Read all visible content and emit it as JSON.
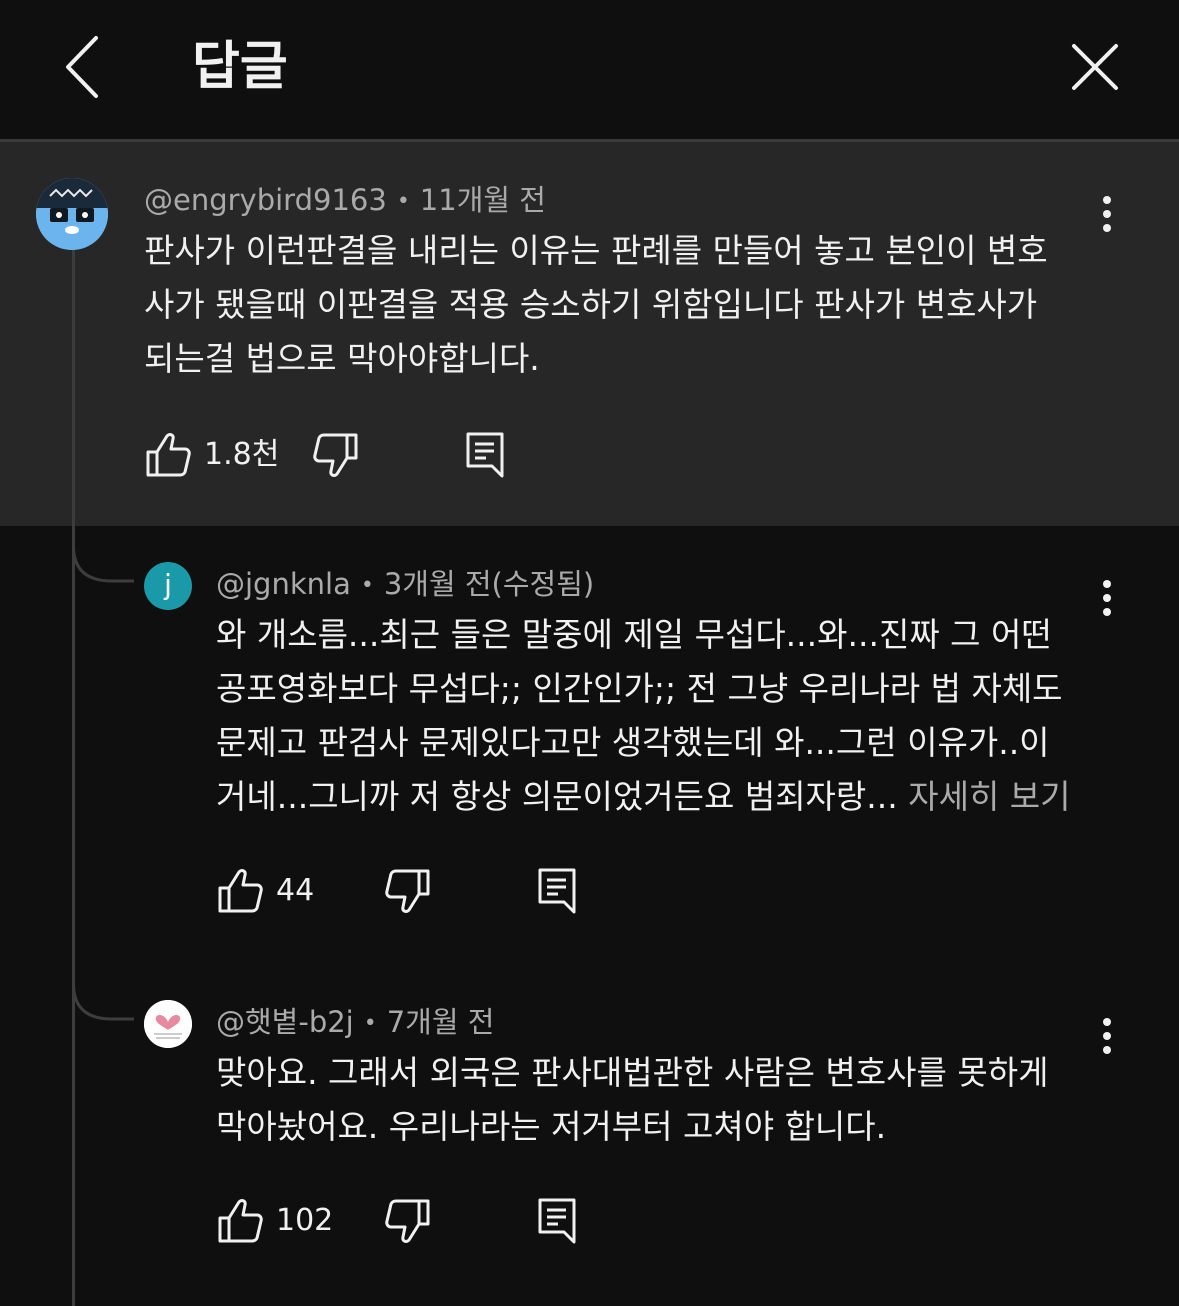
{
  "header": {
    "title": "답글"
  },
  "parent_comment": {
    "handle": "@engrybird9163",
    "time": "11개월 전",
    "lines": [
      "판사가 이런판결을 내리는 이유는 판례를 만들어 놓고 본인이 변호",
      "사가 됐을때 이판결을 적용 승소하기 위함입니다 판사가 변호사가",
      "되는걸 법으로 막아야합니다."
    ],
    "likes": "1.8천"
  },
  "replies": [
    {
      "handle": "@jgnknla",
      "time": "3개월 전(수정됨)",
      "avatar_letter": "j",
      "lines": [
        "와 개소름...최근 들은 말중에 제일 무섭다...와...진짜 그 어떤",
        "공포영화보다 무섭다;; 인간인가;; 전 그냥 우리나라 법 자체도",
        "문제고 판검사 문제있다고만 생각했는데 와...그런 이유가..이",
        "거네...그니까 저 항상 의문이었거든요 범죄자랑... "
      ],
      "more_label": "자세히 보기",
      "likes": "44"
    },
    {
      "handle": "@햇볕-b2j",
      "time": "7개월 전",
      "lines": [
        "맞아요. 그래서 외국은 판사대법관한 사람은 변호사를 못하게",
        "막아놨어요. 우리나라는 저거부터 고쳐야 합니다."
      ],
      "likes": "102"
    }
  ],
  "colors": {
    "background": "#0f0f0f",
    "parent_highlight": "#272727",
    "text_primary": "#f1f1f1",
    "text_secondary": "#aaaaaa",
    "avatar_teal": "#1a9aa8"
  },
  "icons": {
    "back": "chevron-left-icon",
    "close": "close-icon",
    "like": "thumb-up-icon",
    "dislike": "thumb-down-icon",
    "reply": "reply-comment-icon",
    "more": "more-vertical-icon"
  }
}
